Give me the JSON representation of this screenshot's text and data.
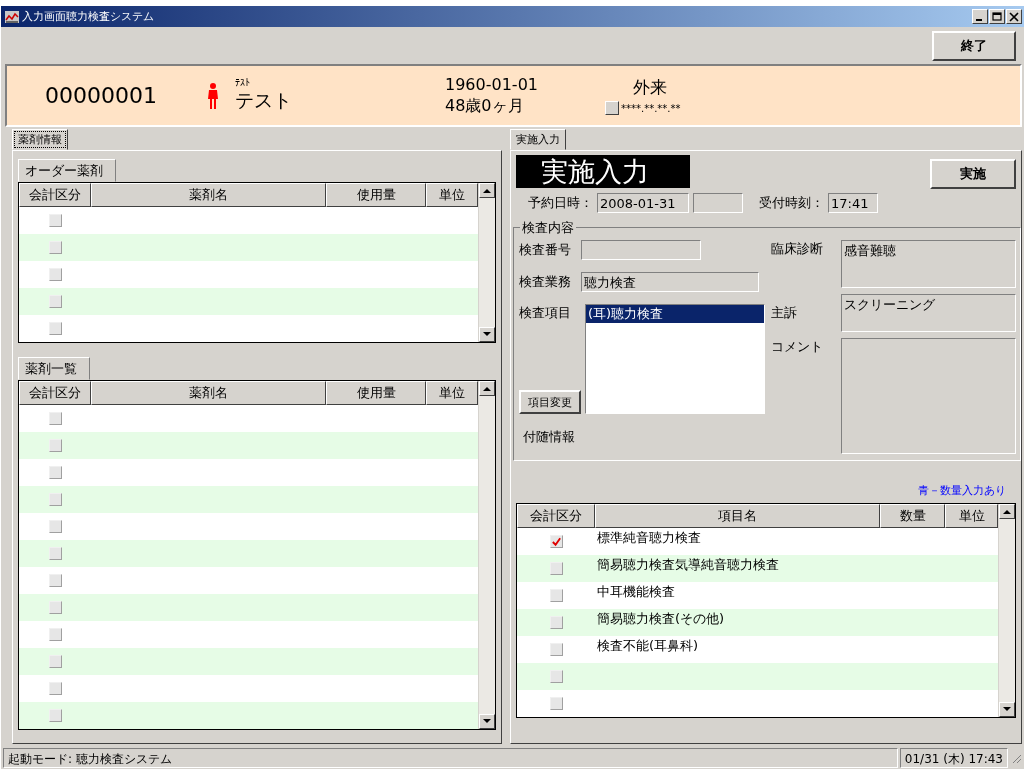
{
  "window": {
    "title": "入力画面聴力検査システム"
  },
  "toolbar": {
    "exit_button": "終了"
  },
  "patient": {
    "id": "00000001",
    "sex_icon": {
      "kind": "female"
    },
    "name_kana": "ﾃｽﾄ",
    "name": "テスト",
    "birth_date": "1960-01-01",
    "age": "48歳0ヶ月",
    "visit_type": "外来",
    "insurance": "****.**.**.**"
  },
  "left_panel": {
    "tab": "薬剤情報",
    "order_drugs": {
      "title": "オーダー薬剤",
      "columns": [
        "会計区分",
        "薬剤名",
        "使用量",
        "単位"
      ],
      "rows": [
        {
          "checked": false
        },
        {
          "checked": false
        },
        {
          "checked": false
        },
        {
          "checked": false
        },
        {
          "checked": false
        }
      ]
    },
    "drug_list": {
      "title": "薬剤一覧",
      "columns": [
        "会計区分",
        "薬剤名",
        "使用量",
        "単位"
      ],
      "rows": [
        {
          "checked": false
        },
        {
          "checked": false
        },
        {
          "checked": false
        },
        {
          "checked": false
        },
        {
          "checked": false
        },
        {
          "checked": false
        },
        {
          "checked": false
        },
        {
          "checked": false
        },
        {
          "checked": false
        },
        {
          "checked": false
        },
        {
          "checked": false
        },
        {
          "checked": false
        }
      ]
    }
  },
  "right_panel": {
    "tab": "実施入力",
    "heading": "実施入力",
    "execute_button": "実施",
    "reservation_label": "予約日時：",
    "reservation_date": "2008-01-31",
    "reception_label": "受付時刻：",
    "reception_time": "17:41",
    "exam_group": {
      "title": "検査内容",
      "exam_number_label": "検査番号",
      "exam_work_label": "検査業務",
      "exam_work": "聴力検査",
      "exam_items_label": "検査項目",
      "exam_items": [
        {
          "label": "(耳)聴力検査",
          "selected": true
        }
      ],
      "change_button": "項目変更",
      "extra_info_label": "付随情報",
      "diagnosis_label": "臨床診断",
      "diagnosis": "感音難聴",
      "complaint_label": "主訴",
      "complaint": "スクリーニング",
      "comment_label": "コメント"
    },
    "legend": "青－数量入力あり",
    "items_table": {
      "columns": [
        "会計区分",
        "項目名",
        "数量",
        "単位"
      ],
      "rows": [
        {
          "name": "標準純音聴力検査",
          "checked": true
        },
        {
          "name": "簡易聴力検査気導純音聴力検査",
          "checked": false
        },
        {
          "name": "中耳機能検査",
          "checked": false
        },
        {
          "name": "簡易聴力検査(その他)",
          "checked": false
        },
        {
          "name": "検査不能(耳鼻科)",
          "checked": false
        },
        {
          "checked": false
        },
        {
          "checked": false
        }
      ]
    }
  },
  "status_bar": {
    "mode": "起動モード:  聴力検査システム",
    "datetime": "01/31 (木) 17:43"
  }
}
